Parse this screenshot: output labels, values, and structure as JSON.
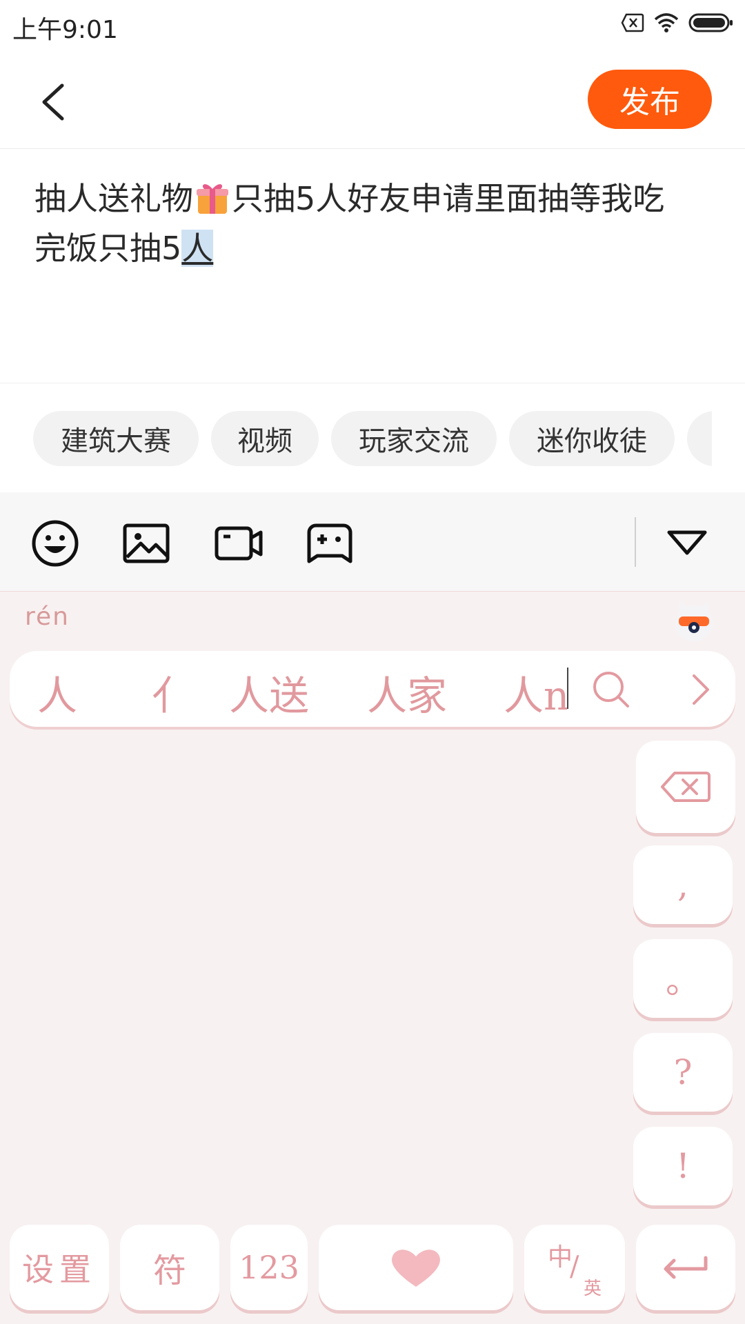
{
  "status_bar": {
    "time": "上午9:01"
  },
  "nav": {
    "publish_label": "发布"
  },
  "editor": {
    "text_line1_a": "抽人送礼物",
    "text_line1_b": "只抽5人好友申请里面抽等我吃",
    "text_line2_a": "完饭只抽5",
    "text_composing": "人"
  },
  "tags": [
    "建筑大赛",
    "视频",
    "玩家交流",
    "迷你收徒"
  ],
  "toolbar": {
    "icons": [
      "emoji-icon",
      "image-icon",
      "video-icon",
      "gamepad-icon",
      "collapse-icon"
    ]
  },
  "keyboard": {
    "pinyin": "rén",
    "candidates": [
      "人",
      "亻",
      "人送",
      "人家",
      "人n"
    ],
    "keys": {
      "comma": ",",
      "period": "。",
      "question": "?",
      "exclaim": "!",
      "settings": "设置",
      "symbols": "符",
      "numbers": "123",
      "lang_zh": "中",
      "lang_en": "英"
    },
    "accent_color": "#e39aa0",
    "background_color": "#f8f1f1"
  },
  "colors": {
    "publish": "#ff5a0d"
  }
}
